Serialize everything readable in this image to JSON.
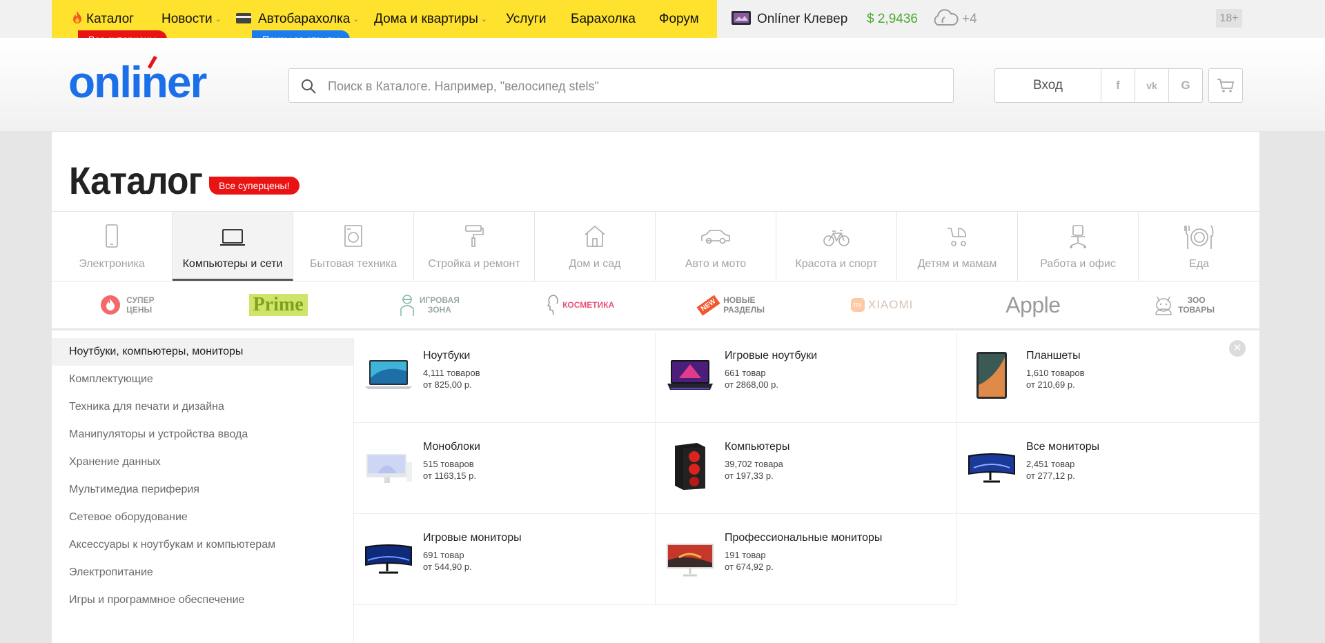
{
  "topbar": {
    "nav": [
      {
        "label": "Каталог",
        "icon": "flame-icon"
      },
      {
        "label": "Новости",
        "dropdown": true
      },
      {
        "label": "Автобарахолка",
        "dropdown": true,
        "icon": "card-icon"
      },
      {
        "label": "Дома и квартиры",
        "dropdown": true
      },
      {
        "label": "Услуги"
      },
      {
        "label": "Барахолка"
      },
      {
        "label": "Форум"
      }
    ],
    "badges": {
      "catalog": "Все суперцены",
      "auto": "Призы за отзывы"
    },
    "clever": "Onlíner Клевер",
    "rate": "$ 2,9436",
    "weather": "+4",
    "age": "18+",
    "colors": {
      "yellow": "#ffe22d",
      "badge_red": "#ea1313",
      "badge_blue": "#1b7cf0",
      "rate_green": "#4caa2d"
    }
  },
  "header": {
    "logo": "onliner",
    "search_placeholder": "Поиск в Каталоге. Например, \"велосипед stels\"",
    "login": "Вход",
    "social": [
      "f",
      "vk",
      "G"
    ],
    "colors": {
      "logo_blue": "#1b6fe8",
      "logo_accent": "#ea1313"
    }
  },
  "page": {
    "title": "Каталог",
    "badge": "Все суперцены!"
  },
  "categories": [
    {
      "label": "Электроника",
      "icon": "phone-icon"
    },
    {
      "label": "Компьютеры и сети",
      "icon": "laptop-icon",
      "active": true
    },
    {
      "label": "Бытовая техника",
      "icon": "washer-icon"
    },
    {
      "label": "Стройка и ремонт",
      "icon": "paint-roller-icon"
    },
    {
      "label": "Дом и сад",
      "icon": "house-icon"
    },
    {
      "label": "Авто и мото",
      "icon": "car-icon"
    },
    {
      "label": "Красота и спорт",
      "icon": "bicycle-icon"
    },
    {
      "label": "Детям и мамам",
      "icon": "stroller-icon"
    },
    {
      "label": "Работа и офис",
      "icon": "office-chair-icon"
    },
    {
      "label": "Еда",
      "icon": "cutlery-icon"
    }
  ],
  "promos": {
    "super": [
      "СУПЕР",
      "ЦЕНЫ"
    ],
    "prime": "Prime",
    "game": [
      "ИГРОВАЯ",
      "ЗОНА"
    ],
    "cosmetics": "КОСМЕТИКА",
    "new": [
      "НОВЫЕ",
      "РАЗДЕЛЫ"
    ],
    "new_tag": "NEW",
    "xiaomi": "XIAOMI",
    "xiaomi_mark": "mi",
    "apple": "Apple",
    "zoo": [
      "ЗОО",
      "ТОВАРЫ"
    ]
  },
  "sidebar": [
    {
      "label": "Ноутбуки, компьютеры, мониторы",
      "active": true
    },
    {
      "label": "Комплектующие"
    },
    {
      "label": "Техника для печати и дизайна"
    },
    {
      "label": "Манипуляторы и устройства ввода"
    },
    {
      "label": "Хранение данных"
    },
    {
      "label": "Мультимедиа периферия"
    },
    {
      "label": "Сетевое оборудование"
    },
    {
      "label": "Аксессуары к ноутбукам и компьютерам"
    },
    {
      "label": "Электропитание"
    },
    {
      "label": "Игры и программное обеспечение"
    }
  ],
  "products": [
    {
      "title": "Ноутбуки",
      "count": "4,111 товаров",
      "price": "от 825,00 р.",
      "image": "laptop-image"
    },
    {
      "title": "Игровые ноутбуки",
      "count": "661 товар",
      "price": "от 2868,00 р.",
      "image": "gaming-laptop-image"
    },
    {
      "title": "Планшеты",
      "count": "1,610 товаров",
      "price": "от 210,69 р.",
      "image": "tablet-image"
    },
    {
      "title": "Моноблоки",
      "count": "515 товаров",
      "price": "от 1163,15 р.",
      "image": "all-in-one-image"
    },
    {
      "title": "Компьютеры",
      "count": "39,702 товара",
      "price": "от 197,33 р.",
      "image": "pc-tower-image"
    },
    {
      "title": "Все мониторы",
      "count": "2,451 товар",
      "price": "от 277,12 р.",
      "image": "monitor-image"
    },
    {
      "title": "Игровые мониторы",
      "count": "691 товар",
      "price": "от 544,90 р.",
      "image": "gaming-monitor-image"
    },
    {
      "title": "Профессиональные мониторы",
      "count": "191 товар",
      "price": "от 674,92 р.",
      "image": "pro-monitor-image"
    }
  ]
}
